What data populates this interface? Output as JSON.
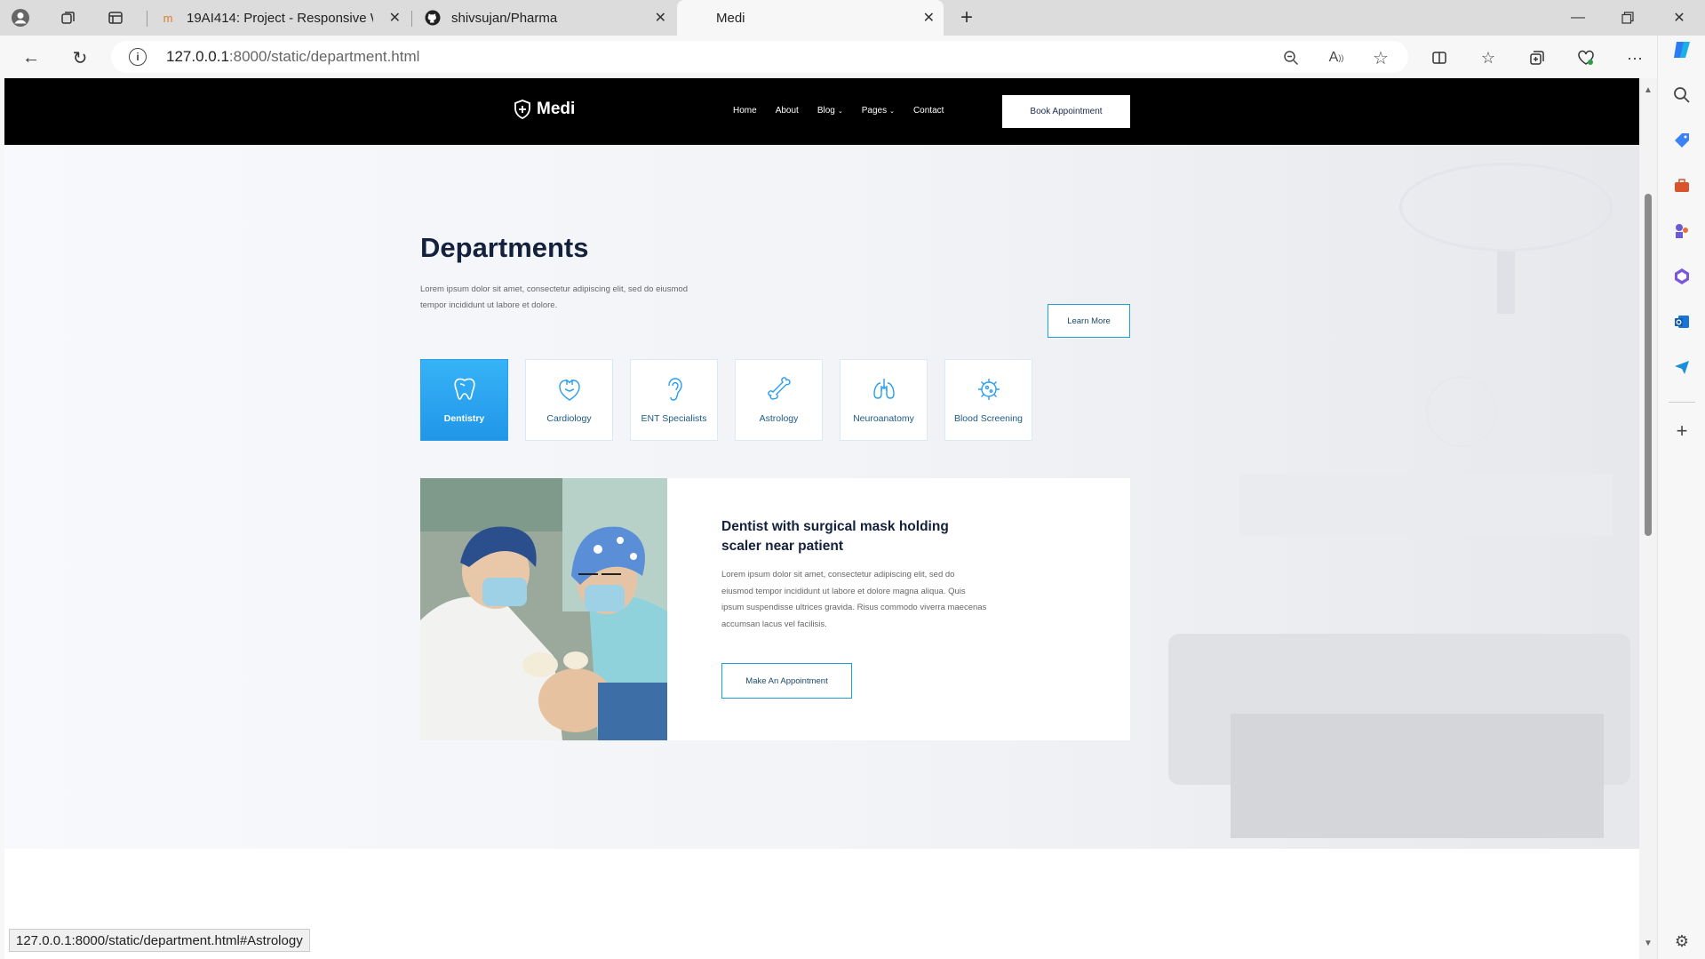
{
  "browser": {
    "tabs": [
      {
        "title": "19AI414: Project - Responsive W",
        "icon": "moodle-icon"
      },
      {
        "title": "shivsujan/Pharma",
        "icon": "github-icon"
      },
      {
        "title": "Medi",
        "icon": "blank-page-icon"
      }
    ],
    "url_host": "127.0.0.1",
    "url_rest": ":8000/static/department.html",
    "status_url": "127.0.0.1:8000/static/department.html#Astrology"
  },
  "site": {
    "brand": "Medi",
    "nav": [
      "Home",
      "About",
      "Blog",
      "Pages",
      "Contact"
    ],
    "book_button": "Book Appointment"
  },
  "departments": {
    "title": "Departments",
    "description": "Lorem ipsum dolor sit amet, consectetur adipiscing elit, sed do eiusmod tempor incididunt ut labore et dolore.",
    "learn_more": "Learn More",
    "items": [
      {
        "label": "Dentistry",
        "icon": "tooth-icon"
      },
      {
        "label": "Cardiology",
        "icon": "heart-icon"
      },
      {
        "label": "ENT Specialists",
        "icon": "ear-icon"
      },
      {
        "label": "Astrology",
        "icon": "bone-icon"
      },
      {
        "label": "Neuroanatomy",
        "icon": "lungs-icon"
      },
      {
        "label": "Blood Screening",
        "icon": "virus-icon"
      }
    ],
    "active_index": 0
  },
  "detail": {
    "title": "Dentist with surgical mask holding scaler near patient",
    "text": "Lorem ipsum dolor sit amet, consectetur adipiscing elit, sed do eiusmod tempor incididunt ut labore et dolore magna aliqua. Quis ipsum suspendisse ultrices gravida. Risus commodo viverra maecenas accumsan lacus vel facilisis.",
    "button": "Make An Appointment"
  },
  "colors": {
    "accent": "#2a9df0",
    "header_bg": "#000000",
    "title": "#14213d"
  }
}
